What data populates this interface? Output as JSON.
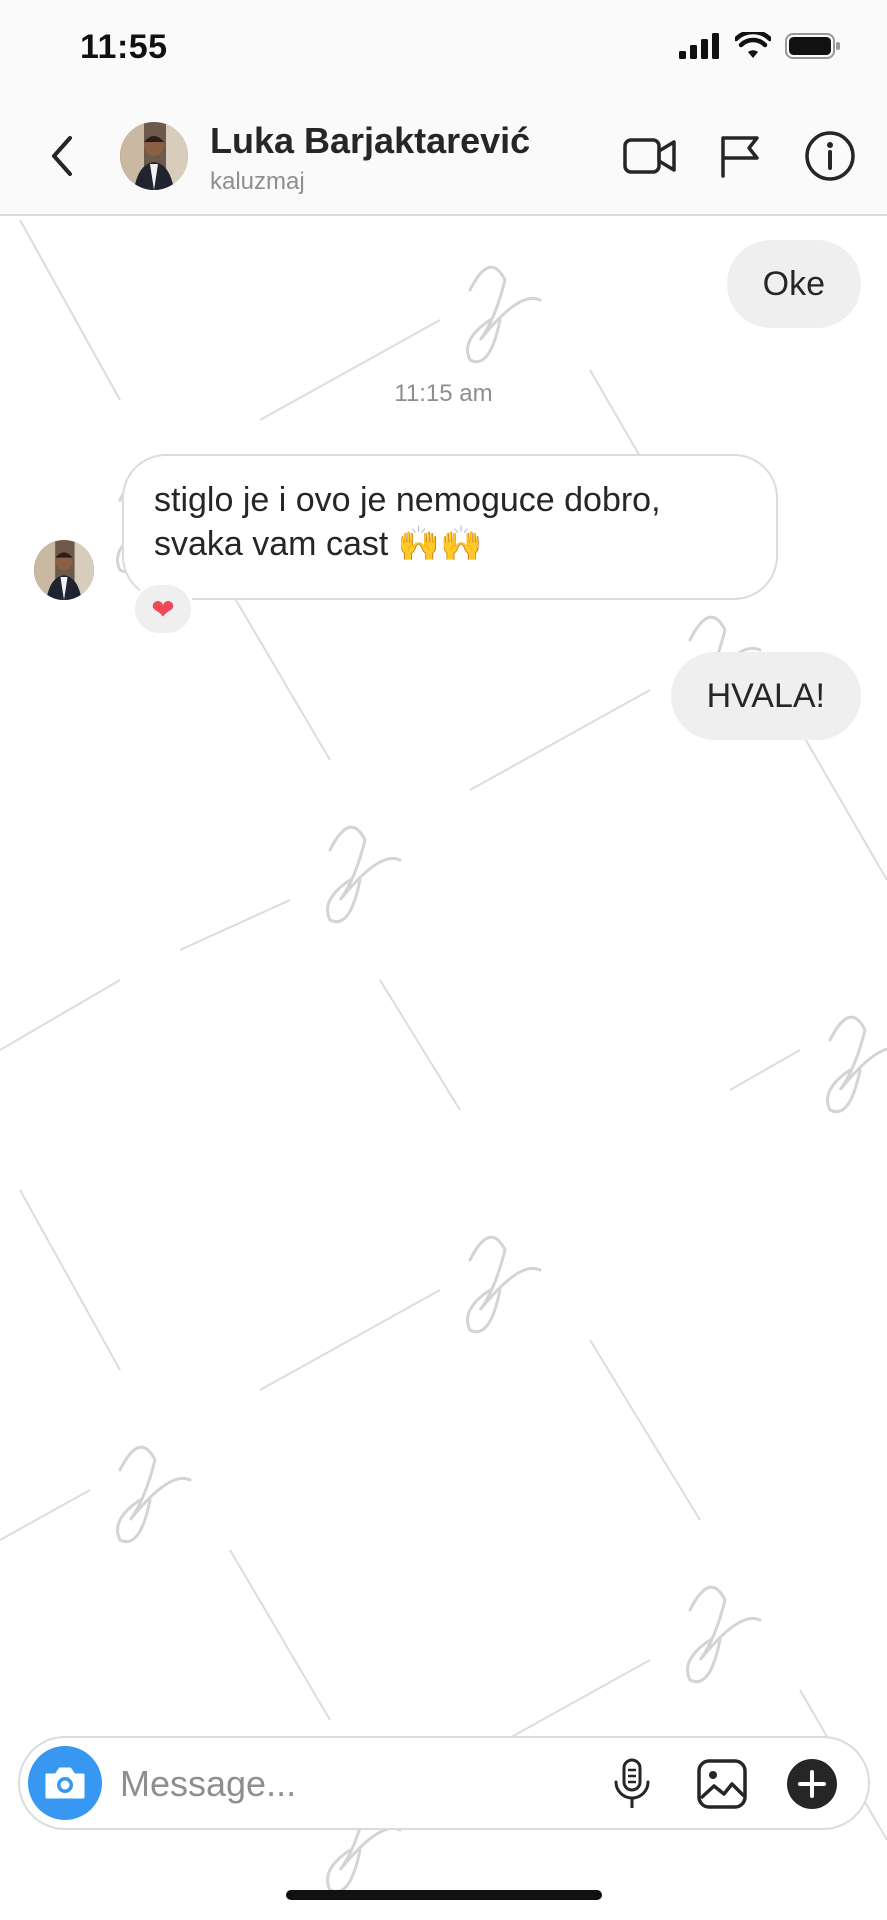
{
  "status_bar": {
    "time": "11:55"
  },
  "header": {
    "name": "Luka Barjaktarević",
    "username": "kaluzmaj"
  },
  "messages": {
    "outgoing_1": "Oke",
    "timestamp": "11:15 am",
    "incoming_1_line1": "stiglo je i ovo je nemoguce dobro,",
    "incoming_1_line2": "svaka vam cast 🙌🙌",
    "incoming_1_reaction": "❤",
    "outgoing_2": "HVALA!"
  },
  "composer": {
    "placeholder": "Message..."
  },
  "icons": {
    "back": "chevron-left-icon",
    "video": "video-camera-icon",
    "report": "flag-icon",
    "info": "info-icon",
    "camera": "camera-icon",
    "mic": "microphone-icon",
    "gallery": "image-icon",
    "plus": "plus-circle-icon"
  },
  "colors": {
    "camera_button": "#3897f0",
    "bubble_outgoing": "#efefef",
    "reaction_heart": "#ed4956",
    "secondary_text": "#8e8e8e"
  }
}
